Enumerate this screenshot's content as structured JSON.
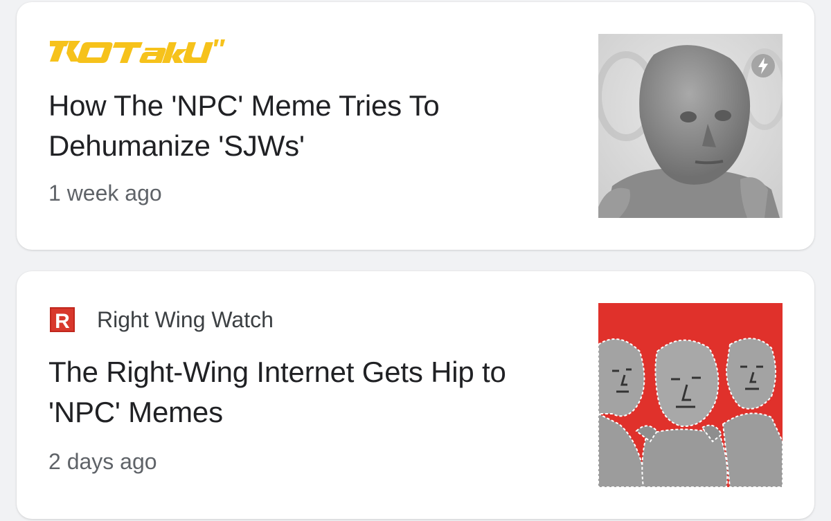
{
  "cards": [
    {
      "source": {
        "name": "KOTAKU",
        "logo_icon": "kotaku-logo",
        "brand_color": "#f6c21b"
      },
      "headline": "How The 'NPC' Meme Tries To Dehumanize 'SJWs'",
      "timestamp": "1 week ago",
      "thumbnail": "npc-grayscale-face-image",
      "badge_icon": "amp-lightning-icon"
    },
    {
      "source": {
        "name": "Right Wing Watch",
        "logo_icon": "rww-r-logo",
        "brand_color": "#c0261c"
      },
      "headline": "The Right-Wing Internet Gets Hip to 'NPC' Memes",
      "timestamp": "2 days ago",
      "thumbnail": "npc-group-red-background-image"
    }
  ]
}
